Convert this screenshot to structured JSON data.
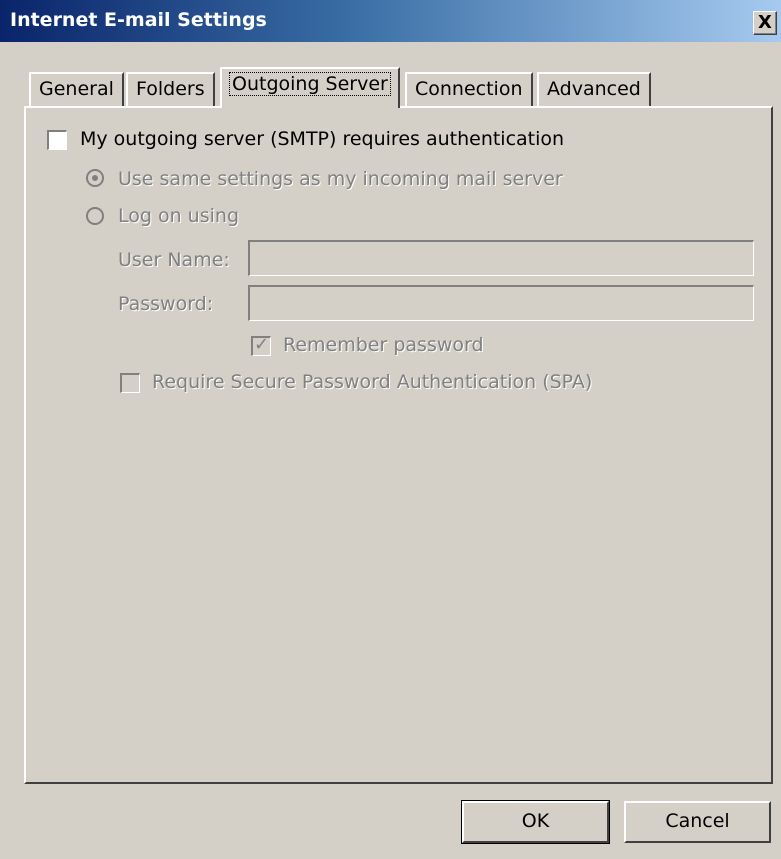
{
  "window": {
    "title": "Internet E-mail Settings",
    "close_label": "X"
  },
  "tabs": [
    {
      "label": "General",
      "active": false
    },
    {
      "label": "Folders",
      "active": false
    },
    {
      "label": "Outgoing Server",
      "active": true
    },
    {
      "label": "Connection",
      "active": false
    },
    {
      "label": "Advanced",
      "active": false
    }
  ],
  "outgoing": {
    "auth_checkbox_label": "My outgoing server (SMTP) requires authentication",
    "auth_checked": false,
    "radio_same_label": "Use same settings as my incoming mail server",
    "radio_same_selected": true,
    "radio_logon_label": "Log on using",
    "username_label": "User Name:",
    "username_value": "",
    "password_label": "Password:",
    "password_value": "",
    "remember_label": "Remember password",
    "remember_checked": true,
    "spa_label": "Require Secure Password Authentication (SPA)",
    "spa_checked": false
  },
  "buttons": {
    "ok": "OK",
    "cancel": "Cancel"
  },
  "colors": {
    "face": "#d4d0c8",
    "title_start": "#0a246a",
    "title_end": "#a6caf0",
    "disabled_text": "#808080"
  }
}
